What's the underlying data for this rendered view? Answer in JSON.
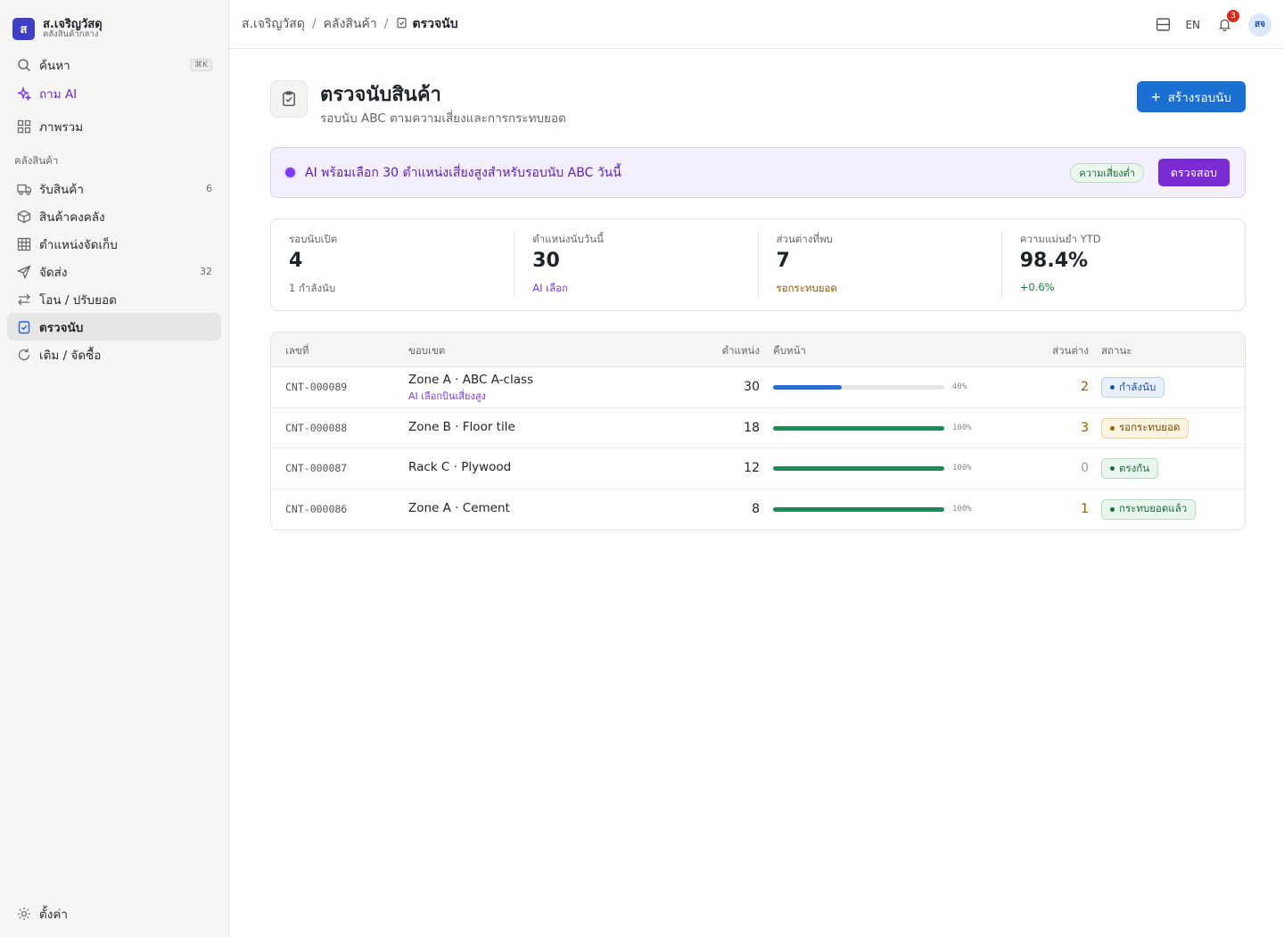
{
  "brand": {
    "logo": "ส",
    "name": "ส.เจริญวัสดุ",
    "sub": "คลังสินค้ากลาง"
  },
  "sidebar": {
    "search": {
      "label": "ค้นหา",
      "shortcut": "⌘K"
    },
    "ask_ai": "ถาม AI",
    "overview": "ภาพรวม",
    "section": "คลังสินค้า",
    "items": [
      {
        "label": "รับสินค้า",
        "count": "6",
        "icon": "truck-icon"
      },
      {
        "label": "สินค้าคงคลัง",
        "count": "",
        "icon": "box-icon"
      },
      {
        "label": "ตำแหน่งจัดเก็บ",
        "count": "",
        "icon": "grid-icon"
      },
      {
        "label": "จัดส่ง",
        "count": "32",
        "icon": "send-icon"
      },
      {
        "label": "โอน / ปรับยอด",
        "count": "",
        "icon": "transfer-icon"
      },
      {
        "label": "ตรวจนับ",
        "count": "",
        "icon": "clipboard-check-icon"
      },
      {
        "label": "เติม / จัดซื้อ",
        "count": "",
        "icon": "refresh-icon"
      }
    ],
    "settings": "ตั้งค่า"
  },
  "topbar": {
    "crumbs": [
      "ส.เจริญวัสดุ",
      "คลังสินค้า"
    ],
    "current": "ตรวจนับ",
    "lang": "EN",
    "notifications": "3",
    "avatar": "สจ"
  },
  "page": {
    "title": "ตรวจนับสินค้า",
    "subtitle": "รอบนับ ABC ตามความเสี่ยงและการกระทบยอด",
    "create_button": "สร้างรอบนับ"
  },
  "ai_banner": {
    "text": "AI พร้อมเลือก 30 ตำแหน่งเสี่ยงสูงสำหรับรอบนับ ABC วันนี้",
    "risk_pill": "ความเสี่ยงต่ำ",
    "button": "ตรวจสอบ"
  },
  "stats": [
    {
      "label": "รอบนับเปิด",
      "value": "4",
      "sub": "1 กำลังนับ",
      "tone": ""
    },
    {
      "label": "ตำแหน่งนับวันนี้",
      "value": "30",
      "sub": "AI เลือก",
      "tone": "purple"
    },
    {
      "label": "ส่วนต่างที่พบ",
      "value": "7",
      "sub": "รอกระทบยอด",
      "tone": "amber"
    },
    {
      "label": "ความแม่นยำ YTD",
      "value": "98.4%",
      "sub": "+0.6%",
      "tone": "green"
    }
  ],
  "table": {
    "headers": {
      "no": "เลขที่",
      "scope": "ขอบเขต",
      "locations": "ตำแหน่ง",
      "progress": "คืบหน้า",
      "diff": "ส่วนต่าง",
      "status": "สถานะ"
    },
    "rows": [
      {
        "no": "CNT-000089",
        "scope": "Zone A · ABC A-class",
        "ai_note": "AI เลือกบินเสี่ยงสูง",
        "locations": "30",
        "progress": 40,
        "progress_label": "40%",
        "progress_color": "#2a6fd0",
        "diff": "2",
        "diff_color": "#8a5a00",
        "status": "กำลังนับ",
        "status_tone": "blue"
      },
      {
        "no": "CNT-000088",
        "scope": "Zone B · Floor tile",
        "ai_note": "",
        "locations": "18",
        "progress": 100,
        "progress_label": "100%",
        "progress_color": "#1f8a55",
        "diff": "3",
        "diff_color": "#8a5a00",
        "status": "รอกระทบยอด",
        "status_tone": "amber"
      },
      {
        "no": "CNT-000087",
        "scope": "Rack C · Plywood",
        "ai_note": "",
        "locations": "12",
        "progress": 100,
        "progress_label": "100%",
        "progress_color": "#1f8a55",
        "diff": "0",
        "diff_color": "#9a9a9a",
        "status": "ตรงกัน",
        "status_tone": "green"
      },
      {
        "no": "CNT-000086",
        "scope": "Zone A · Cement",
        "ai_note": "",
        "locations": "8",
        "progress": 100,
        "progress_label": "100%",
        "progress_color": "#1f8a55",
        "diff": "1",
        "diff_color": "#8a5a00",
        "status": "กระทบยอดแล้ว",
        "status_tone": "green"
      }
    ]
  },
  "colors": {
    "primary": "#1a6fd1",
    "ai_purple": "#7a2bd3",
    "brand_logo": "#3f3fc4"
  }
}
